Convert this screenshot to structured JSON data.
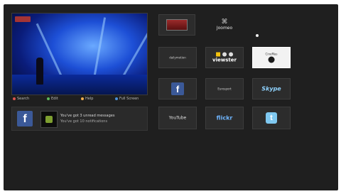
{
  "legend": [
    {
      "label": "Search",
      "color": "#d9534f"
    },
    {
      "label": "Edit",
      "color": "#5cb85c"
    },
    {
      "label": "Help",
      "color": "#f0ad4e"
    },
    {
      "label": "Full Screen",
      "color": "#4a90d9"
    }
  ],
  "notification": {
    "line1": "You've got 3 unread messages",
    "line2": "You've got 10 notifications"
  },
  "apps": {
    "joomeo": "Joomeo",
    "dailymotion": "dailymotion",
    "viewster": "viewster",
    "cinemas": "CineMas",
    "facebook": "f",
    "eurosport": "Eurosport",
    "skype": "Skype",
    "youtube": "YouTube",
    "flickr": "flickr",
    "twitter": "t"
  }
}
